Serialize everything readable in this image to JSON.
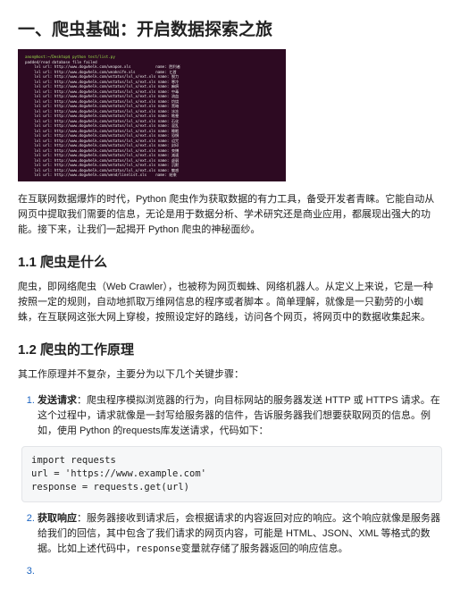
{
  "h1": "一、爬虫基础：开启数据探索之旅",
  "terminal": {
    "line0": "anon@host:~/Desktop$ python test/list.py",
    "line1": "padded/read database file failed",
    "lines": [
      "lvl url: http://www.dogwhelk.com/weapon.xls           name: 胜利者",
      "lvl url: http://www.dogwhelk.com/weaknife.xls         name: 匕首",
      "lvl url: http://www.dogwhelk.com/wstatus/lvl_x/ext.xls name: 脱力",
      "lvl url: http://www.dogwhelk.com/wstatus/lvl_x/ext.xls name: 寒冷",
      "lvl url: http://www.dogwhelk.com/wstatus/lvl_x/ext.xls name: 麻痹",
      "lvl url: http://www.dogwhelk.com/wstatus/lvl_x/ext.xls name: 中毒",
      "lvl url: http://www.dogwhelk.com/wstatus/lvl_x/ext.xls name: 流血",
      "lvl url: http://www.dogwhelk.com/wstatus/lvl_x/ext.xls name: 灼烧",
      "lvl url: http://www.dogwhelk.com/wstatus/lvl_x/ext.xls name: 黑暗",
      "lvl url: http://www.dogwhelk.com/wstatus/lvl_x/ext.xls name: 冰冻",
      "lvl url: http://www.dogwhelk.com/wstatus/lvl_x/ext.xls name: 眩晕",
      "lvl url: http://www.dogwhelk.com/wstatus/lvl_x/ext.xls name: 石化",
      "lvl url: http://www.dogwhelk.com/wstatus/lvl_x/ext.xls name: 混乱",
      "lvl url: http://www.dogwhelk.com/wstatus/lvl_x/ext.xls name: 睡眠",
      "lvl url: http://www.dogwhelk.com/wstatus/lvl_x/ext.xls name: 恐惧",
      "lvl url: http://www.dogwhelk.com/wstatus/lvl_x/ext.xls name: 诅咒",
      "lvl url: http://www.dogwhelk.com/wstatus/lvl_x/ext.xls name: 封印",
      "lvl url: http://www.dogwhelk.com/wstatus/lvl_x/ext.xls name: 束缚",
      "lvl url: http://www.dogwhelk.com/wstatus/lvl_x/ext.xls name: 减速",
      "lvl url: http://www.dogwhelk.com/wstatus/lvl_x/ext.xls name: 虚弱",
      "lvl url: http://www.dogwhelk.com/wstatus/lvl_x/ext.xls name: 沉默",
      "lvl url: http://www.dogwhelk.com/wstatus/lvl_x/ext.xls name: 魅惑",
      "lvl url: http://www.dogwhelk.com/wend/linelist.xls    name: 结束"
    ]
  },
  "intro": "在互联网数据爆炸的时代，Python 爬虫作为获取数据的有力工具，备受开发者青睐。它能自动从网页中提取我们需要的信息，无论是用于数据分析、学术研究还是商业应用，都展现出强大的功能。接下来，让我们一起揭开 Python 爬虫的神秘面纱。",
  "s11_title": "1.1 爬虫是什么",
  "s11_body": "爬虫，即网络爬虫（Web Crawler），也被称为网页蜘蛛、网络机器人。从定义上来说，它是一种按照一定的规则，自动地抓取万维网信息的程序或者脚本 。简单理解，就像是一只勤劳的小蜘蛛，在互联网这张大网上穿梭，按照设定好的路线，访问各个网页，将网页中的数据收集起来。",
  "s12_title": "1.2 爬虫的工作原理",
  "s12_lead": "其工作原理并不复杂，主要分为以下几个关键步骤：",
  "step1_b": "发送请求",
  "step1_t": "：爬虫程序模拟浏览器的行为，向目标网站的服务器发送 HTTP 或 HTTPS 请求。在这个过程中，请求就像是一封写给服务器的信件，告诉服务器我们想要获取网页的信息。例如，使用 Python 的requests库发送请求，代码如下：",
  "code1": "import requests\nurl = 'https://www.example.com'\nresponse = requests.get(url)",
  "step2_b": "获取响应",
  "step2_t1": "：服务器接收到请求后，会根据请求的内容返回对应的响应。这个响应就像是服务器给我们的回信，其中包含了我们请求的网页内容，可能是 HTML、JSON、XML 等格式的数据。比如上述代码中，",
  "step2_code": "response",
  "step2_t2": "变量就存储了服务器返回的响应信息。"
}
